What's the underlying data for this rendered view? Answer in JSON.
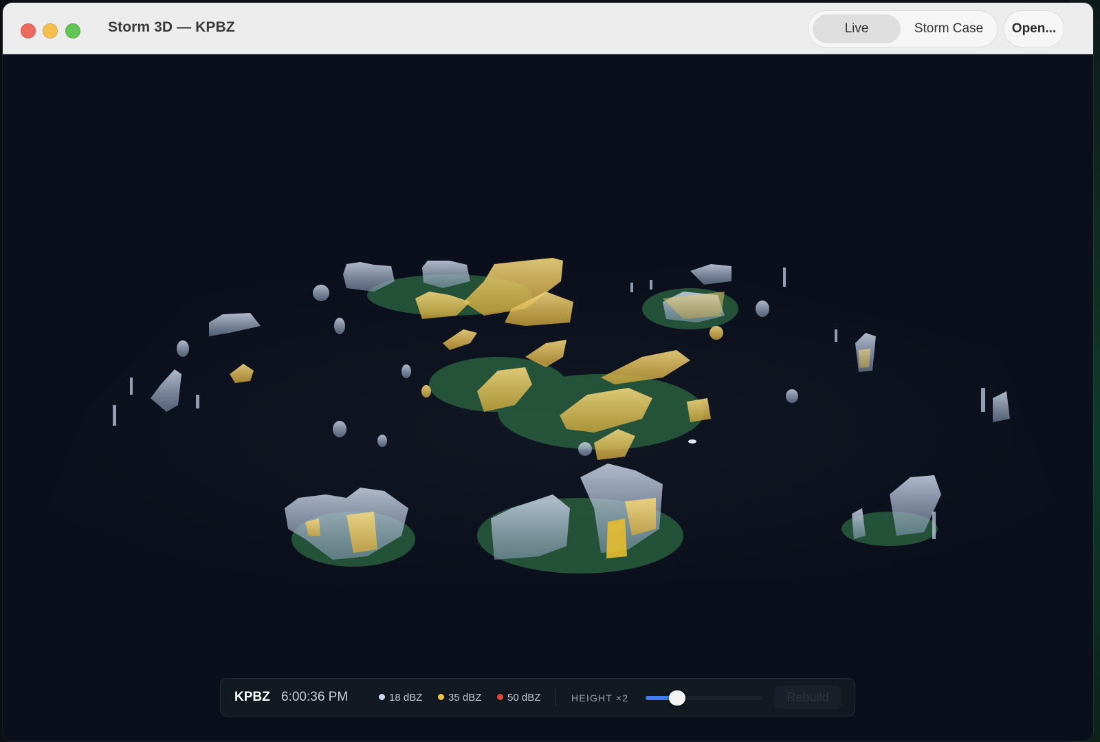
{
  "window": {
    "title": "Storm 3D — KPBZ"
  },
  "toolbar": {
    "mode_options": [
      "Live",
      "Storm Case"
    ],
    "selected_mode": "Live",
    "open_label": "Open..."
  },
  "hud": {
    "station": "KPBZ",
    "time": "6:00:36 PM",
    "legend": [
      {
        "label": "18 dBZ",
        "color": "#c9d6ee"
      },
      {
        "label": "35 dBZ",
        "color": "#f0c43c"
      },
      {
        "label": "50 dBZ",
        "color": "#e2473b"
      }
    ],
    "height_label": "HEIGHT ×2",
    "height_slider": {
      "min": 1,
      "max": 5,
      "value": 2
    },
    "rebuild_label": "Rebuild"
  }
}
